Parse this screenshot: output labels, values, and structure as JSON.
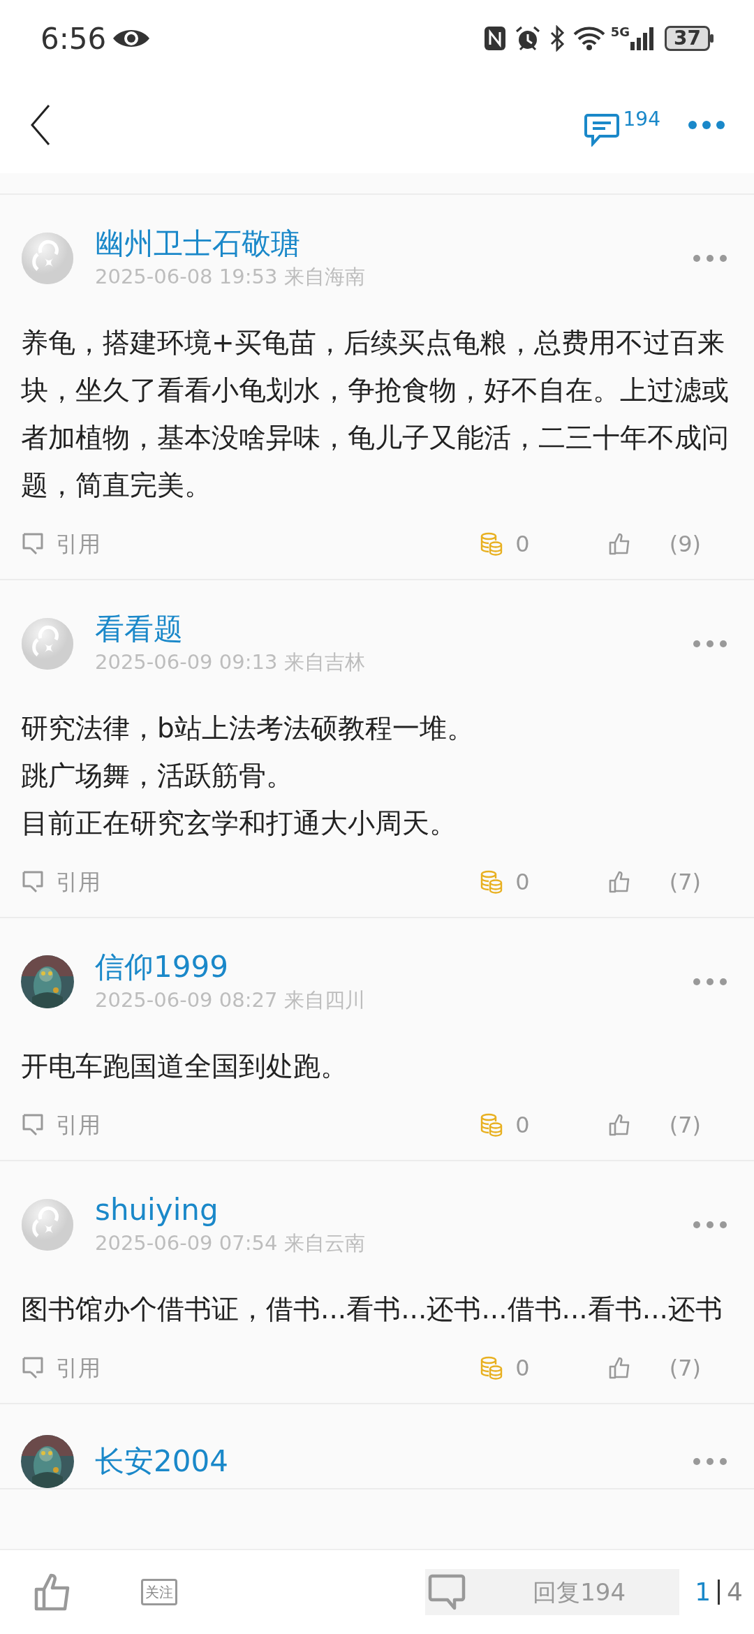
{
  "status_bar": {
    "time": "6:56",
    "network": "5G",
    "battery": "37"
  },
  "top_bar": {
    "reply_count": "194"
  },
  "posts": [
    {
      "author": "幽州卫士石敬瑭",
      "avatar": {
        "kind": "default"
      },
      "date": "2025-06-08 19:53 来自海南",
      "body": [
        "养龟，搭建环境+买龟苗，后续买点龟粮，总费用不过百来块，坐久了看看小龟划水，争抢食物，好不自在。上过滤或者加植物，基本没啥异味，龟儿子又能活，二三十年不成问题，简直完美。"
      ],
      "quote_label": "引用",
      "coins": "0",
      "likes": "(9)"
    },
    {
      "author": "看看题",
      "avatar": {
        "kind": "default"
      },
      "date": "2025-06-09 09:13 来自吉林",
      "body": [
        "研究法律，b站上法考法硕教程一堆。",
        "跳广场舞，活跃筋骨。",
        "目前正在研究玄学和打通大小周天。"
      ],
      "quote_label": "引用",
      "coins": "0",
      "likes": "(7)"
    },
    {
      "author": "信仰1999",
      "date": "2025-06-09 08:27 来自四川",
      "body": [
        "开电车跑国道全国到处跑。"
      ],
      "quote_label": "引用",
      "coins": "0",
      "likes": "(7)"
    },
    {
      "author": "shuiying",
      "avatar": {
        "kind": "default"
      },
      "date": "2025-06-09 07:54 来自云南",
      "body": [
        "图书馆办个借书证，借书...看书...还书...借书...看书...还书"
      ],
      "quote_label": "引用",
      "coins": "0",
      "likes": "(7)"
    },
    {
      "author": "长安2004"
    }
  ],
  "bottom_bar": {
    "follow_label": "关注",
    "reply_label": "回复194",
    "page_current": "1",
    "page_total": "4"
  }
}
